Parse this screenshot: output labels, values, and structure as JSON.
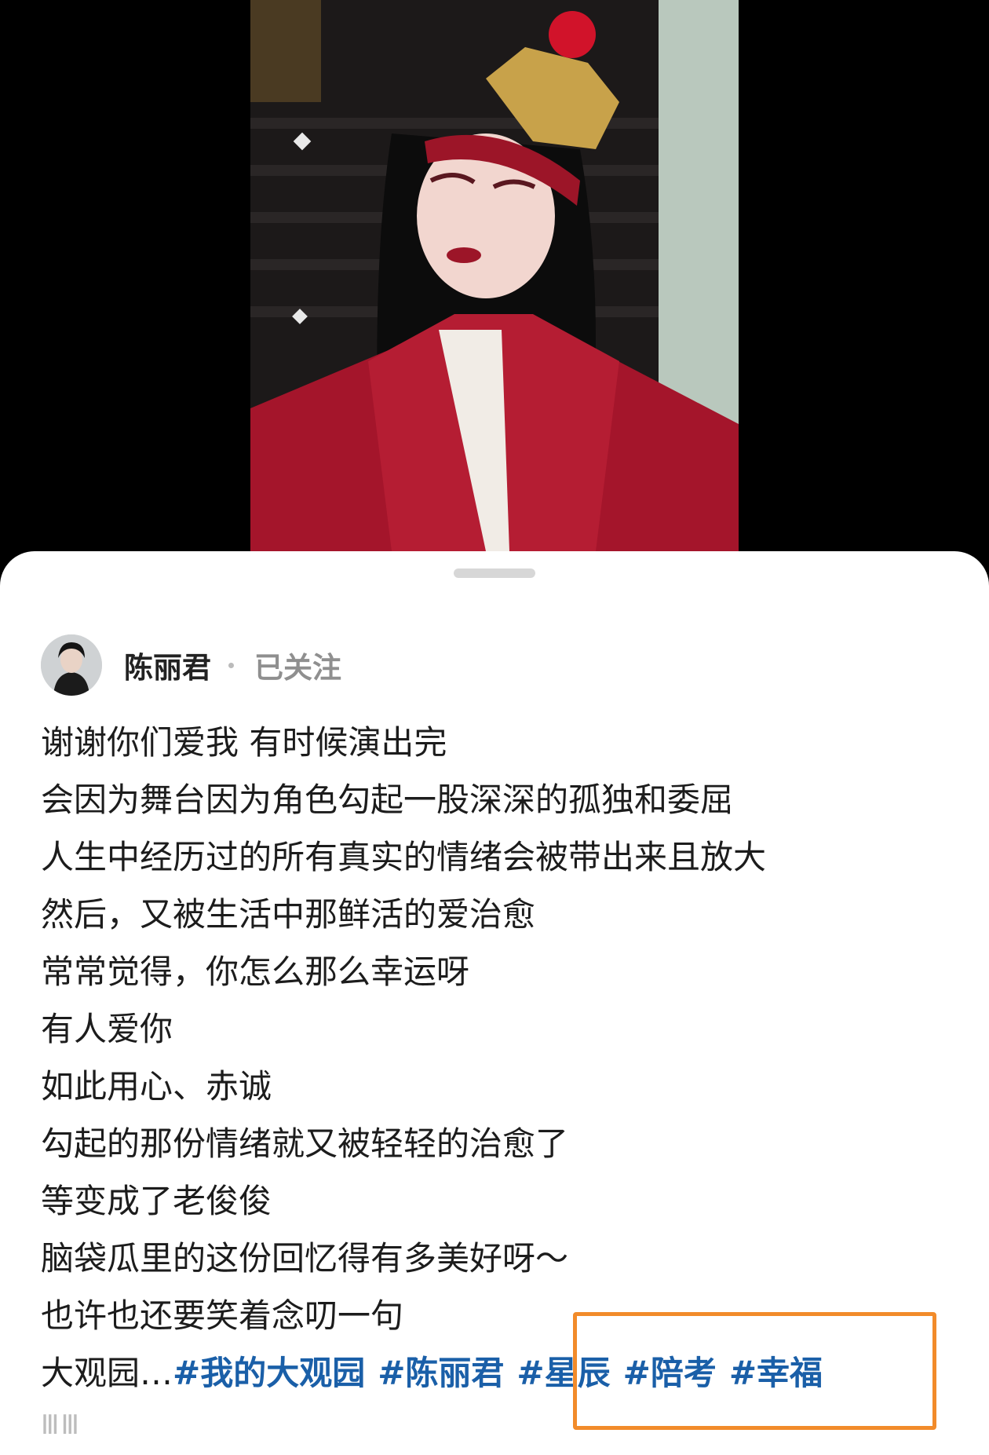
{
  "author": {
    "name": "陈丽君",
    "follow_status": "已关注"
  },
  "post": {
    "lines": [
      "谢谢你们爱我 有时候演出完",
      "会因为舞台因为角色勾起一股深深的孤独和委屈",
      "人生中经历过的所有真实的情绪会被带出来且放大",
      "然后，又被生活中那鲜活的爱治愈",
      "常常觉得，你怎么那么幸运呀",
      "有人爱你",
      "如此用心、赤诚",
      "勾起的那份情绪就又被轻轻的治愈了",
      "等变成了老俊俊",
      "脑袋瓜里的这份回忆得有多美好呀～",
      "也许也还要笑着念叨一句"
    ],
    "last_line_prefix": "大观园…",
    "hashtags": [
      "#我的大观园",
      "#陈丽君",
      "#星辰",
      "#陪考",
      "#幸福"
    ]
  },
  "footer": {
    "watermark": "ⅢⅢ"
  },
  "colors": {
    "hashtag": "#1a5fa8",
    "highlight_border": "#f28b2a",
    "sheet_background": "#ffffff"
  },
  "icons": {
    "drag_handle": "drag-handle"
  }
}
